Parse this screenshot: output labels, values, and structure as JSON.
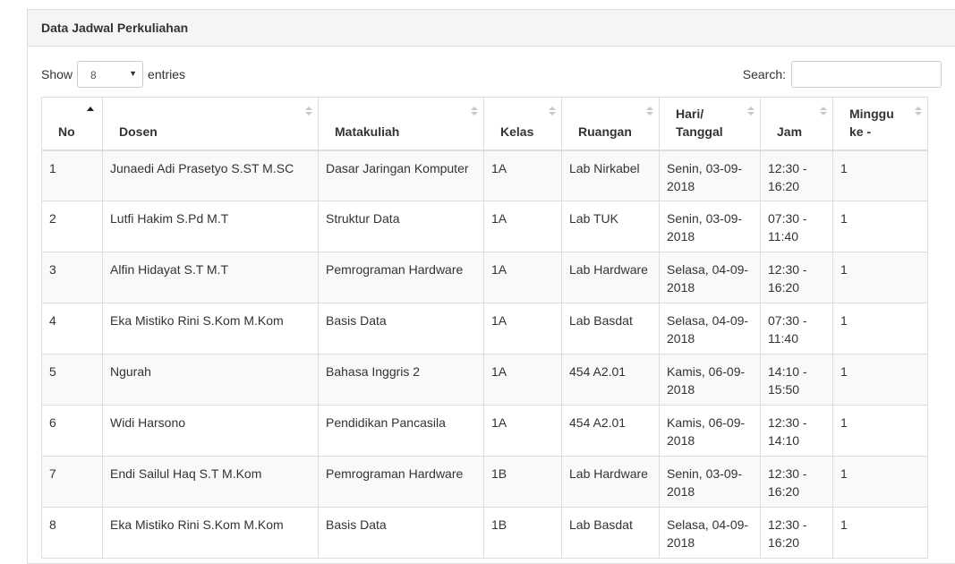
{
  "panel": {
    "title": "Data Jadwal Perkuliahan"
  },
  "length": {
    "prefix": "Show",
    "value": "8",
    "suffix": "entries"
  },
  "search": {
    "label": "Search:",
    "value": ""
  },
  "columns": [
    "No",
    "Dosen",
    "Matakuliah",
    "Kelas",
    "Ruangan",
    "Hari/ Tanggal",
    "Jam",
    "Minggu ke -"
  ],
  "rows": [
    [
      "1",
      "Junaedi Adi Prasetyo S.ST M.SC",
      "Dasar Jaringan Komputer",
      "1A",
      "Lab Nirkabel",
      "Senin, 03-09-2018",
      "12:30 - 16:20",
      "1"
    ],
    [
      "2",
      "Lutfi Hakim S.Pd M.T",
      "Struktur Data",
      "1A",
      "Lab TUK",
      "Senin, 03-09-2018",
      "07:30 - 11:40",
      "1"
    ],
    [
      "3",
      "Alfin Hidayat S.T M.T",
      "Pemrograman Hardware",
      "1A",
      "Lab Hardware",
      "Selasa, 04-09-2018",
      "12:30 - 16:20",
      "1"
    ],
    [
      "4",
      "Eka Mistiko Rini S.Kom M.Kom",
      "Basis Data",
      "1A",
      "Lab Basdat",
      "Selasa, 04-09-2018",
      "07:30 - 11:40",
      "1"
    ],
    [
      "5",
      "Ngurah",
      "Bahasa Inggris 2",
      "1A",
      "454 A2.01",
      "Kamis, 06-09-2018",
      "14:10 - 15:50",
      "1"
    ],
    [
      "6",
      "Widi Harsono",
      "Pendidikan Pancasila",
      "1A",
      "454 A2.01",
      "Kamis, 06-09-2018",
      "12:30 - 14:10",
      "1"
    ],
    [
      "7",
      "Endi Sailul Haq S.T M.Kom",
      "Pemrograman Hardware",
      "1B",
      "Lab Hardware",
      "Senin, 03-09-2018",
      "12:30 - 16:20",
      "1"
    ],
    [
      "8",
      "Eka Mistiko Rini S.Kom M.Kom",
      "Basis Data",
      "1B",
      "Lab Basdat",
      "Selasa, 04-09-2018",
      "12:30 - 16:20",
      "1"
    ]
  ]
}
